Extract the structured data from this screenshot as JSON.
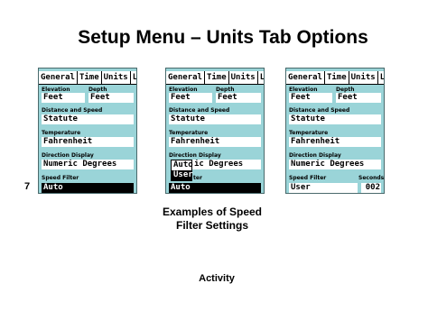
{
  "slide": {
    "title": "Setup Menu – Units Tab Options",
    "number": "7",
    "caption_line1": "Examples of Speed",
    "caption_line2": "Filter Settings",
    "activity": "Activity"
  },
  "screens": [
    {
      "tabs": [
        "General",
        "Time",
        "Units",
        "L:"
      ],
      "elevation_label": "Elevation",
      "depth_label": "Depth",
      "elevation": "Feet",
      "depth": "Feet",
      "distance_label": "Distance and Speed",
      "distance": "Statute",
      "temperature_label": "Temperature",
      "temperature": "Fahrenheit",
      "direction_label": "Direction Display",
      "direction": "Numeric Degrees",
      "speed_filter_label": "Speed Filter",
      "speed_filter": "Auto"
    },
    {
      "tabs": [
        "General",
        "Time",
        "Units",
        "L:"
      ],
      "elevation_label": "Elevation",
      "depth_label": "Depth",
      "elevation": "Feet",
      "depth": "Feet",
      "distance_label": "Distance and Speed",
      "distance": "Statute",
      "temperature_label": "Temperature",
      "temperature": "Fahrenheit",
      "direction_label": "Direction Display",
      "direction_partial": "ic Degrees",
      "speed_filter_label_partial": "ter",
      "speed_filter": "Auto",
      "popup_options": [
        "Auto",
        "User"
      ]
    },
    {
      "tabs": [
        "General",
        "Time",
        "Units",
        "L:"
      ],
      "elevation_label": "Elevation",
      "depth_label": "Depth",
      "elevation": "Feet",
      "depth": "Feet",
      "distance_label": "Distance and Speed",
      "distance": "Statute",
      "temperature_label": "Temperature",
      "temperature": "Fahrenheit",
      "direction_label": "Direction Display",
      "direction": "Numeric Degrees",
      "speed_filter_label": "Speed Filter",
      "seconds_label": "Seconds",
      "speed_filter": "User",
      "seconds": "002"
    }
  ]
}
